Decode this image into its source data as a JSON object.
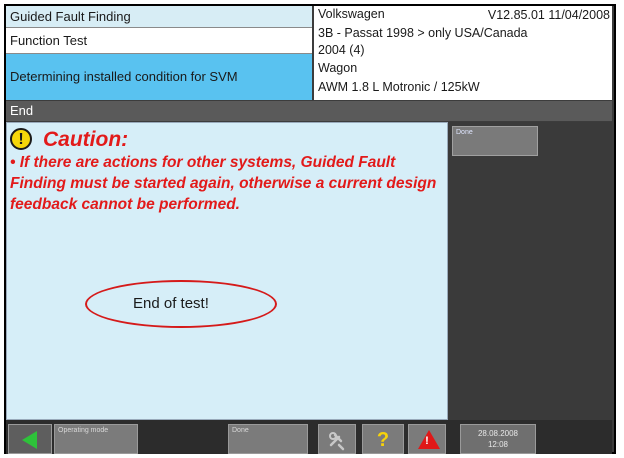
{
  "header": {
    "title": "Guided Fault Finding",
    "section": "Function Test",
    "step": "Determining installed condition for SVM"
  },
  "vehicle": {
    "make": "Volkswagen",
    "version": "V12.85.01 11/04/2008",
    "model": "3B - Passat 1998 > only USA/Canada",
    "year": "2004 (4)",
    "body": "Wagon",
    "engine": "AWM 1.8 L Motronic / 125kW"
  },
  "status_bar": {
    "label": "End"
  },
  "caution": {
    "title": "Caution:",
    "text": "• If there are actions for other systems, Guided Fault Finding must be started again, otherwise a current design feedback cannot be performed.",
    "icon": "exclamation-icon"
  },
  "result": {
    "message": "End of test!"
  },
  "side_panel": {
    "done_label": "Done"
  },
  "toolbar": {
    "back_icon": "back-arrow-icon",
    "mode_label": "Operating mode",
    "done_label": "Done",
    "tools_icon": "tools-icon",
    "help_label": "?",
    "warning_icon": "warning-icon",
    "warning_mark": "!",
    "date": "28.08.2008",
    "time": "12:08"
  },
  "colors": {
    "accent_blue": "#59c2f0",
    "content_bg": "#d6eef8",
    "caution_red": "#e21a1a",
    "back_green": "#2ec23a"
  }
}
